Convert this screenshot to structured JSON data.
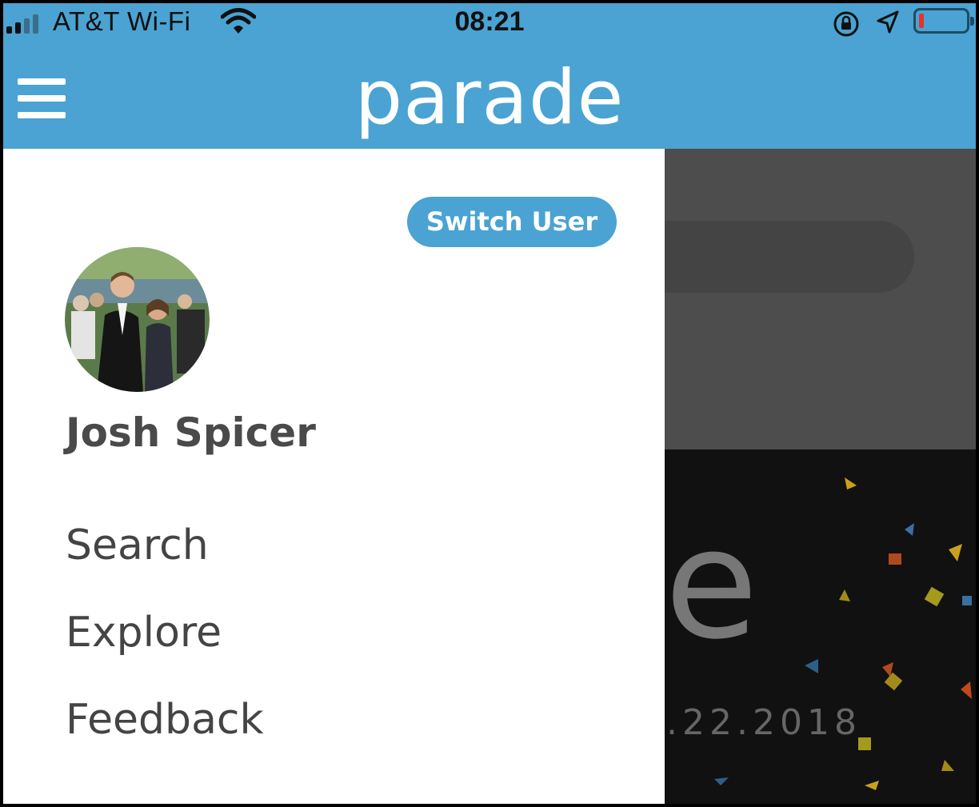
{
  "status_bar": {
    "carrier": "AT&T Wi-Fi",
    "time": "08:21",
    "battery_color": "#e5322e"
  },
  "header": {
    "logo": "parade",
    "menu_icon": "hamburger-icon",
    "color": "#4aa3d2"
  },
  "drawer": {
    "switch_user_label": "Switch User",
    "user_name": "Josh Spicer",
    "menu_items": [
      "Search",
      "Explore",
      "Feedback"
    ]
  },
  "background": {
    "letter": "e",
    "date_fragment": ".22.2018"
  }
}
